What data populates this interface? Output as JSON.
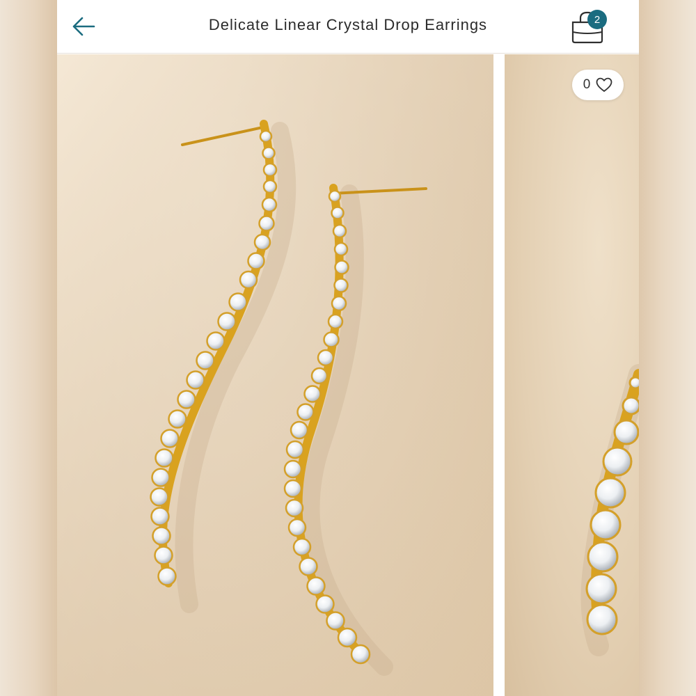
{
  "header": {
    "title": "Delicate Linear Crystal Drop Earrings",
    "back_icon": "arrow-left-icon",
    "bag_icon": "shopping-bag-icon",
    "bag_count": "2"
  },
  "gallery": {
    "like_count": "0",
    "like_icon": "heart-outline-icon"
  },
  "colors": {
    "accent": "#1b6c80",
    "badge": "#1b6c80",
    "gold": "#d9a21f",
    "background": "#e9d7bd"
  }
}
